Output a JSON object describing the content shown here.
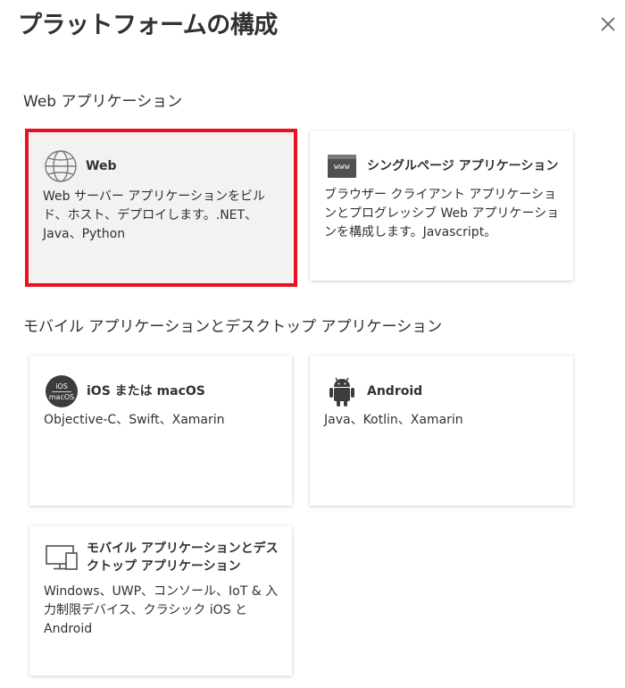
{
  "header": {
    "title": "プラットフォームの構成"
  },
  "sections": {
    "web": "Web アプリケーション",
    "mobile": "モバイル アプリケーションとデスクトップ アプリケーション"
  },
  "cards": {
    "web": {
      "title": "Web",
      "desc": "Web サーバー アプリケーションをビルド、ホスト、デプロイします。.NET、Java、Python",
      "icon": "globe-icon",
      "selected": true
    },
    "spa": {
      "title": "シングルページ アプリケーション",
      "desc": "ブラウザー クライアント アプリケーションとプログレッシブ Web アプリケーションを構成します。Javascript。",
      "icon": "www-browser-icon",
      "icon_text": "www"
    },
    "ios": {
      "title": "iOS または macOS",
      "desc": "Objective-C、Swift、Xamarin",
      "icon": "ios-macos-icon",
      "icon_top": "iOS",
      "icon_bottom": "macOS"
    },
    "android": {
      "title": "Android",
      "desc": "Java、Kotlin、Xamarin",
      "icon": "android-icon"
    },
    "desktop": {
      "title": "モバイル アプリケーションとデスクトップ アプリケーション",
      "desc": "Windows、UWP、コンソール、IoT & 入力制限デバイス、クラシック iOS と Android",
      "icon": "desktop-mobile-icon"
    }
  },
  "colors": {
    "selected_border": "#e81123",
    "selected_bg": "#f3f2f1",
    "text": "#323130"
  }
}
